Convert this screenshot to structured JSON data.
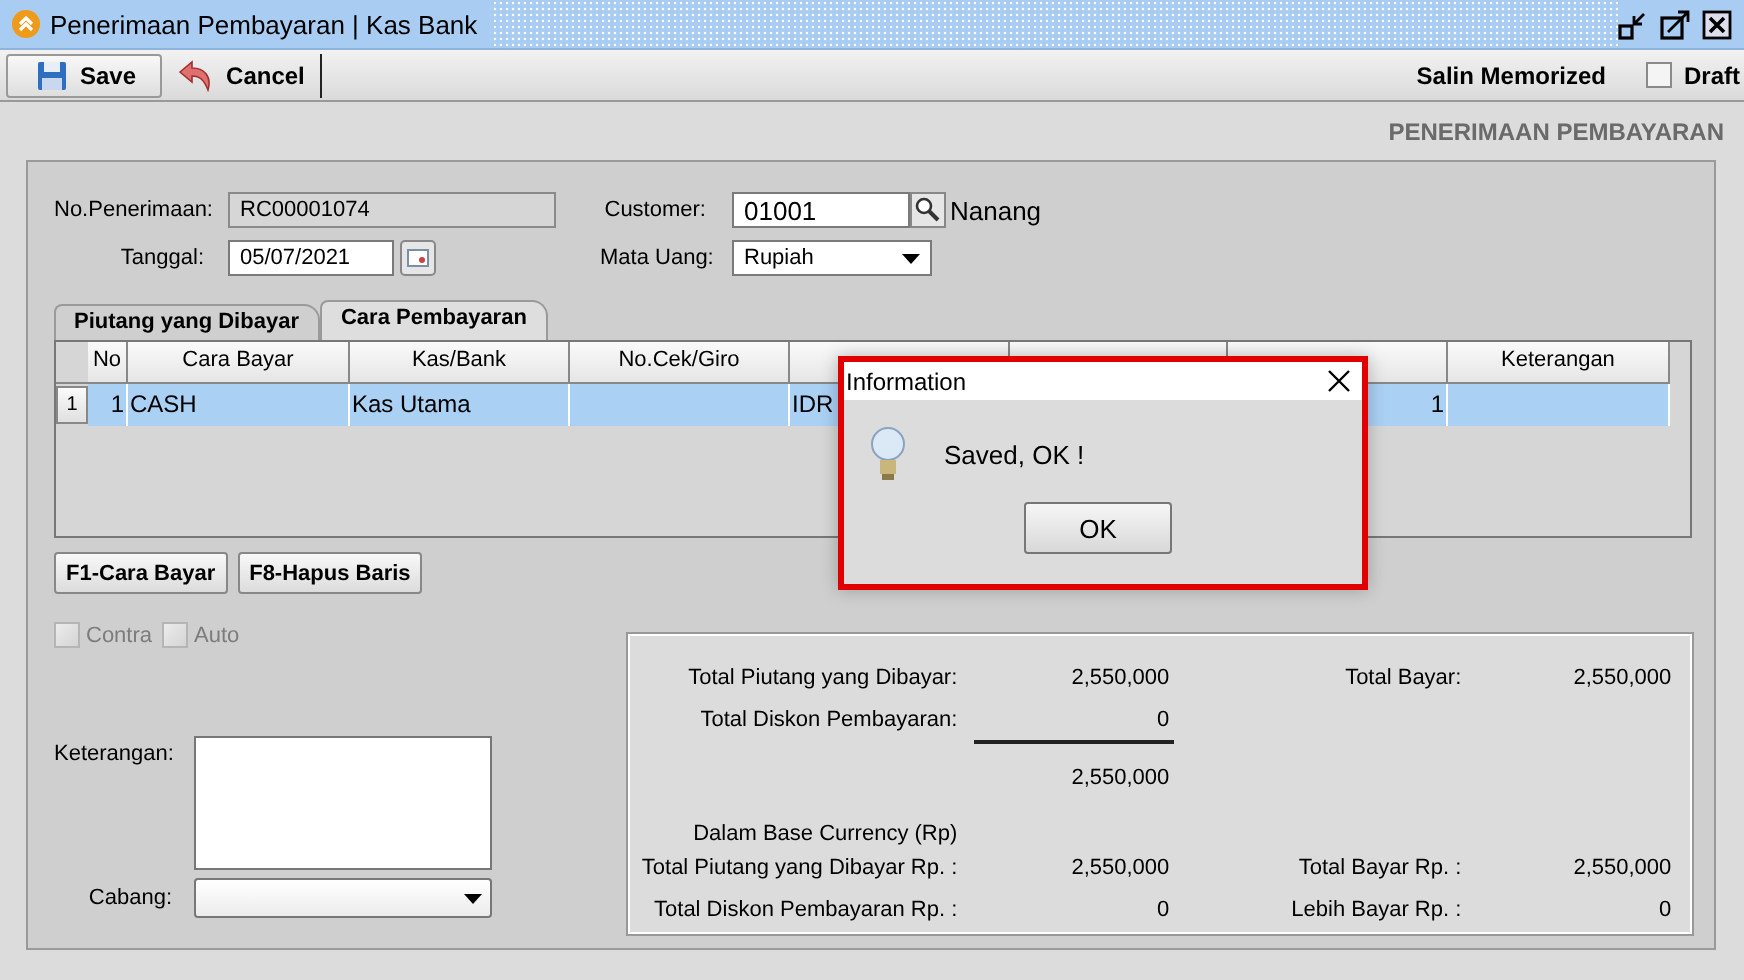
{
  "window": {
    "title": "Penerimaan Pembayaran | Kas Bank"
  },
  "toolbar": {
    "buttons": [
      {
        "label": "Save",
        "kind": "save"
      },
      {
        "label": "Cancel",
        "kind": "cancel"
      }
    ],
    "salin_memorized": "Salin Memorized",
    "draft": {
      "label": "Draft",
      "checked": false
    }
  },
  "form_title": "PENERIMAAN PEMBAYARAN",
  "header": {
    "no_penerimaan": {
      "label": "No.Penerimaan:",
      "value": "RC00001074"
    },
    "tanggal": {
      "label": "Tanggal:",
      "value": "05/07/2021"
    },
    "customer": {
      "label": "Customer:",
      "value": "01001",
      "name": "Nanang"
    },
    "mata_uang": {
      "label": "Mata Uang:",
      "value": "Rupiah"
    }
  },
  "tabs": [
    {
      "label": "Piutang yang Dibayar",
      "selected": false
    },
    {
      "label": "Cara Pembayaran",
      "selected": true
    }
  ],
  "table": {
    "columns": [
      "No",
      "Cara Bayar",
      "Kas/Bank",
      "No.Cek/Giro",
      null,
      null,
      null,
      "Keterangan"
    ],
    "rows": [
      {
        "row_number": "1",
        "selected": true,
        "cells": [
          "1",
          "CASH",
          "Kas Utama",
          null,
          "IDR",
          null,
          "1",
          null
        ]
      }
    ]
  },
  "table_buttons": [
    "F1-Cara Bayar",
    "F8-Hapus Baris"
  ],
  "options": [
    {
      "label": "Contra",
      "checked": false,
      "disabled": true
    },
    {
      "label": "Auto",
      "checked": false,
      "disabled": true
    }
  ],
  "keterangan": {
    "label": "Keterangan:"
  },
  "cabang": {
    "label": "Cabang:"
  },
  "summary": {
    "rows": [
      {
        "kind": "pair",
        "label": "Total Piutang yang Dibayar:",
        "value": "2,550,000",
        "label2": "Total Bayar:",
        "value2": "2,550,000"
      },
      {
        "kind": "pair",
        "label": "Total Diskon Pembayaran:",
        "value": "0"
      },
      {
        "kind": "rule"
      },
      {
        "kind": "pair",
        "value": "2,550,000"
      },
      {
        "kind": "heading",
        "label": "Dalam Base Currency (Rp)"
      },
      {
        "kind": "pair",
        "label": "Total Piutang yang Dibayar Rp. :",
        "value": "2,550,000",
        "label2": "Total Bayar Rp. :",
        "value2": "2,550,000"
      },
      {
        "kind": "pair",
        "label": "Total Diskon Pembayaran Rp. :",
        "value": "0",
        "label2": "Lebih Bayar Rp. :",
        "value2": "0"
      }
    ]
  },
  "dialog": {
    "title": "Information",
    "message": "Saved, OK !",
    "button": "OK"
  }
}
